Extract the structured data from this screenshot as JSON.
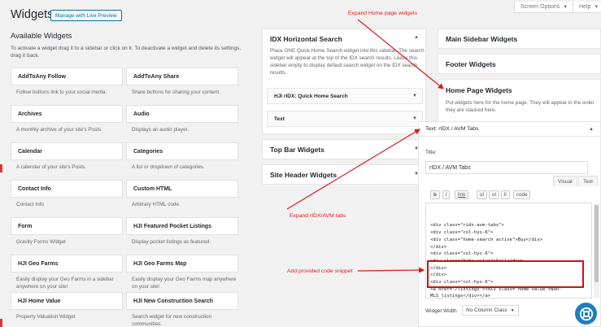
{
  "header": {
    "title": "Widgets",
    "live_preview_label": "Manage with Live Preview",
    "screen_options_label": "Screen Options",
    "help_label": "Help"
  },
  "available": {
    "heading": "Available Widgets",
    "description": "To activate a widget drag it to a sidebar or click on it. To deactivate a widget and delete its settings, drag it back.",
    "widgets": [
      {
        "name": "AddToAny Follow",
        "desc": "Follow buttons link to your social media."
      },
      {
        "name": "AddToAny Share",
        "desc": "Share buttons for sharing your content."
      },
      {
        "name": "Archives",
        "desc": "A monthly archive of your site's Posts."
      },
      {
        "name": "Audio",
        "desc": "Displays an audio player."
      },
      {
        "name": "Calendar",
        "desc": "A calendar of your site's Posts."
      },
      {
        "name": "Categories",
        "desc": "A list or dropdown of categories."
      },
      {
        "name": "Contact Info",
        "desc": "Contact Info"
      },
      {
        "name": "Custom HTML",
        "desc": "Arbitrary HTML code."
      },
      {
        "name": "Form",
        "desc": "Gravity Forms Widget"
      },
      {
        "name": "HJI Featured Pocket Listings",
        "desc": "Display pocket listings as featured."
      },
      {
        "name": "HJI Geo Farms",
        "desc": "Easily display your Geo Farms in a sidebar anywhere on your site!"
      },
      {
        "name": "HJI Geo Farms Map",
        "desc": "Easily display your Geo Farms map anywhere on your site!"
      },
      {
        "name": "HJI Home Value",
        "desc": "Property Valuation Widget"
      },
      {
        "name": "HJI New Construction Search",
        "desc": "Search widget for new construction communities."
      }
    ]
  },
  "sidebars": {
    "idx": {
      "title": "IDX Horizontal Search",
      "description": "Place ONE Quick Home Search widget into this sidebar. The search widget will appear at the top of the IDX search results. Leave this sidebar empty to display default search widget on the IDX search results.",
      "widgets": [
        "HJI rIDX: Quick Home Search",
        "Text"
      ]
    },
    "top_bar": "Top Bar Widgets",
    "site_header": "Site Header Widgets",
    "main": "Main Sidebar Widgets",
    "footer": "Footer Widgets",
    "home": {
      "title": "Home Page Widgets",
      "description": "Put widgets here for the home page. They will appear in the order they are stacked here."
    }
  },
  "text_widget": {
    "header": "Text: rIDX / AVM Tabs",
    "title_label": "Title:",
    "title_value": "rIDX / AVM Tabs",
    "tab_visual": "Visual",
    "tab_text": "Text",
    "quicktags": [
      "b",
      "i",
      "link",
      "ul",
      "ol",
      "li",
      "code"
    ],
    "code_lines": [
      "<div class=\"ridx-avm-tabs\">",
      "<div class=\"col-hys-6\">",
      "<div class=\"home-search active\">Buy</div>",
      "</div>",
      "<div class=\"col-hys-6\">",
      "<div class=\"home-value\">Sell</div>",
      "</div>",
      "</div>",
      "<div class=\"col-hys-6\">",
      "<a href=\"/listings\"><div class=\"home-value\">Non-",
      "MLS listings</div></a>",
      "</div>"
    ],
    "width_label": "Widget Width",
    "width_value": "No Column Class"
  },
  "annotations": {
    "expand_home": "Expand Home page widgets",
    "expand_tabs": "Expand rIDX/AVM tabs",
    "add_code": "Add provided code snippet"
  },
  "colors": {
    "accent": "#0073aa",
    "annotation": "#e01a1a",
    "help_circle": "#1d7fc2"
  }
}
